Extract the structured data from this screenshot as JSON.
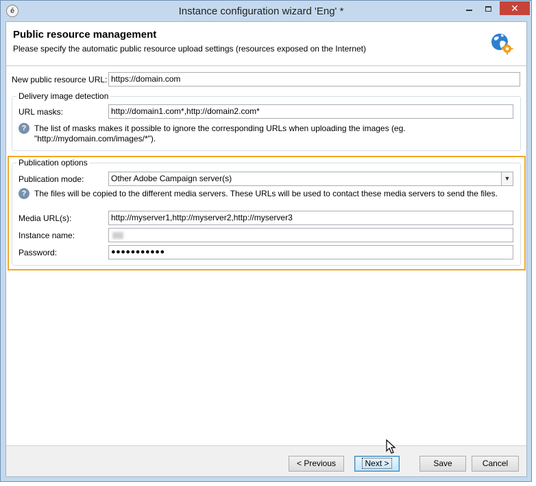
{
  "window": {
    "title": "Instance configuration wizard 'Eng' *",
    "app_icon": "é",
    "close_glyph": "✕"
  },
  "header": {
    "title": "Public resource management",
    "subtitle": "Please specify the automatic public resource upload settings (resources exposed on the Internet)",
    "icon": "globe-gear-icon"
  },
  "form": {
    "public_url_label": "New public resource URL:",
    "public_url_value": "https://domain.com",
    "delivery_group": {
      "legend": "Delivery image detection",
      "url_masks_label": "URL masks:",
      "url_masks_value": "http://domain1.com*,http://domain2.com*",
      "info_line1": "The list of masks makes it possible to ignore the corresponding URLs when uploading the images (eg.",
      "info_line2": "\"http://mydomain.com/images/*\")."
    },
    "publication_group": {
      "legend": "Publication options",
      "mode_label": "Publication mode:",
      "mode_value": "Other Adobe Campaign server(s)",
      "info_text": "The files will be copied to the different media servers. These URLs will be used to contact these media servers to send the files.",
      "media_urls_label": "Media URL(s):",
      "media_urls_value": "http://myserver1,http://myserver2,http://myserver3",
      "instance_label": "Instance name:",
      "password_label": "Password:",
      "password_value": "●●●●●●●●●●●"
    }
  },
  "footer": {
    "previous_label": "< Previous",
    "next_label": "Next >",
    "save_label": "Save",
    "cancel_label": "Cancel"
  },
  "colors": {
    "highlight": "#f5a623",
    "info_icon": "#7891ad",
    "close_button": "#c7433a"
  }
}
